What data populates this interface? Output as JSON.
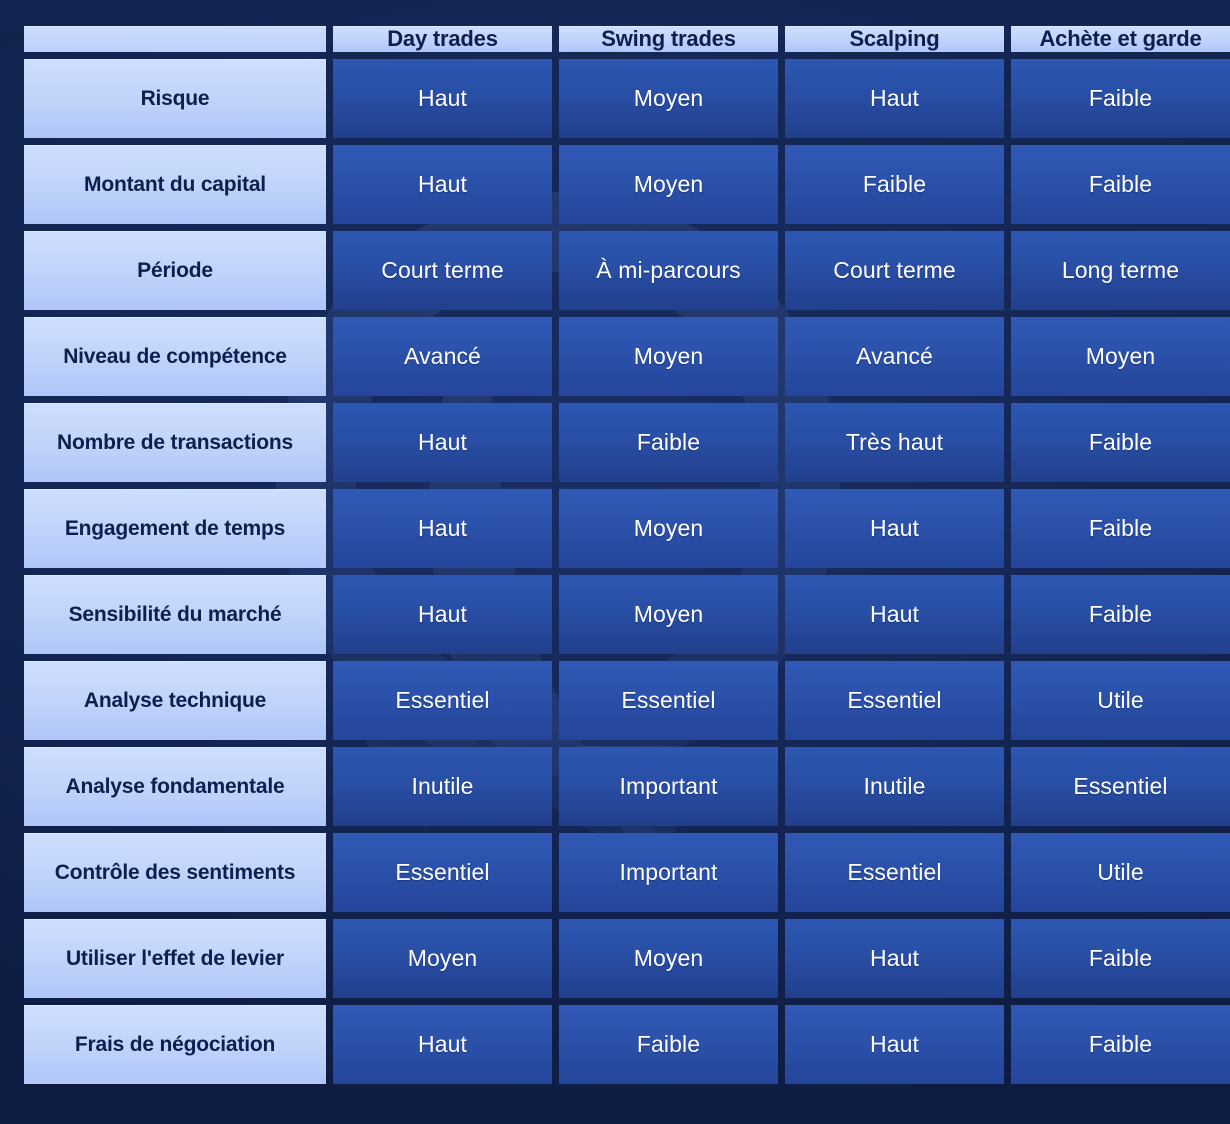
{
  "theme": {
    "page_bg": "#10204d",
    "light_cell": "#c3d5fb",
    "light_text": "#0e1f4e",
    "dark_cell": "#2950a7",
    "dark_text": "#ffffff",
    "watermark": "#3a63bd"
  },
  "table": {
    "corner_label": "",
    "columns": [
      "Day trades",
      "Swing trades",
      "Scalping",
      "Achète et garde"
    ],
    "rows": [
      {
        "label": "Risque",
        "values": [
          "Haut",
          "Moyen",
          "Haut",
          "Faible"
        ]
      },
      {
        "label": "Montant du capital",
        "values": [
          "Haut",
          "Moyen",
          "Faible",
          "Faible"
        ]
      },
      {
        "label": "Période",
        "values": [
          "Court terme",
          "À mi-parcours",
          "Court terme",
          "Long terme"
        ]
      },
      {
        "label": "Niveau de compétence",
        "values": [
          "Avancé",
          "Moyen",
          "Avancé",
          "Moyen"
        ]
      },
      {
        "label": "Nombre de transactions",
        "values": [
          "Haut",
          "Faible",
          "Très haut",
          "Faible"
        ]
      },
      {
        "label": "Engagement de temps",
        "values": [
          "Haut",
          "Moyen",
          "Haut",
          "Faible"
        ]
      },
      {
        "label": "Sensibilité du marché",
        "values": [
          "Haut",
          "Moyen",
          "Haut",
          "Faible"
        ]
      },
      {
        "label": "Analyse technique",
        "values": [
          "Essentiel",
          "Essentiel",
          "Essentiel",
          "Utile"
        ]
      },
      {
        "label": "Analyse fondamentale",
        "values": [
          "Inutile",
          "Important",
          "Inutile",
          "Essentiel"
        ]
      },
      {
        "label": "Contrôle des sentiments",
        "values": [
          "Essentiel",
          "Important",
          "Essentiel",
          "Utile"
        ]
      },
      {
        "label": "Utiliser l'effet de levier",
        "values": [
          "Moyen",
          "Moyen",
          "Haut",
          "Faible"
        ]
      },
      {
        "label": "Frais de négociation",
        "values": [
          "Haut",
          "Faible",
          "Haut",
          "Faible"
        ]
      }
    ]
  }
}
